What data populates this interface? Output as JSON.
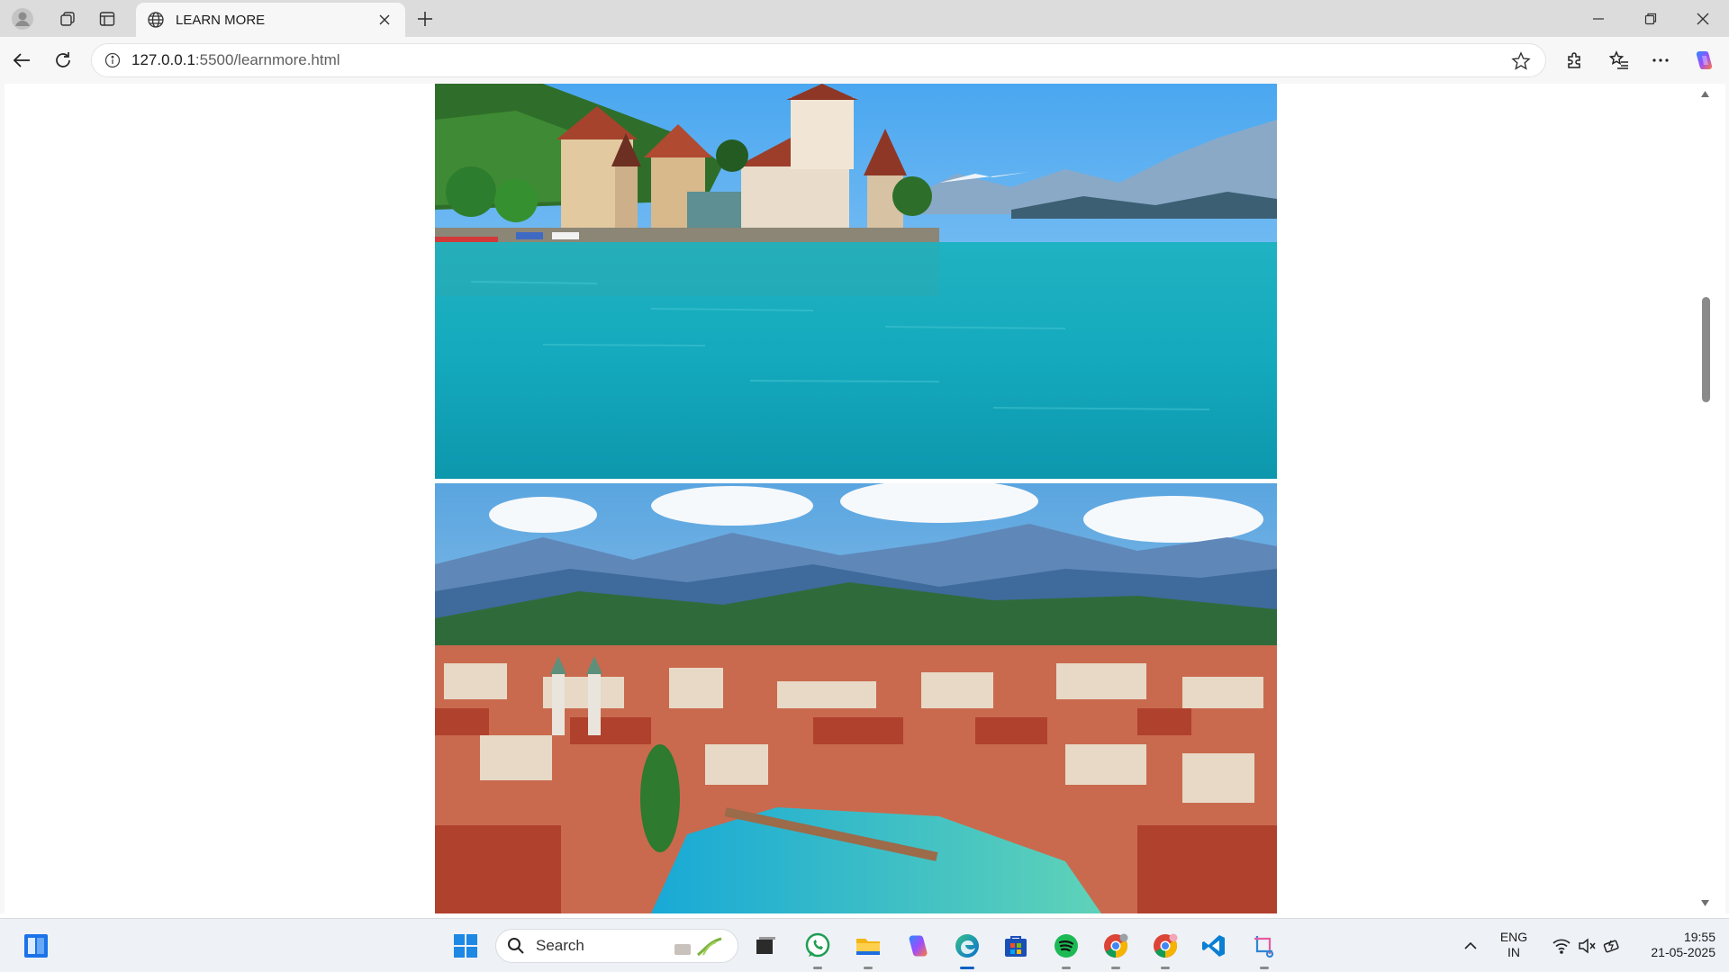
{
  "browser": {
    "tab": {
      "title": "LEARN MORE",
      "icon": "globe-icon"
    },
    "address_bar": {
      "host": "127.0.0.1",
      "path": ":5500/learnmore.html"
    }
  },
  "page": {
    "images": [
      {
        "name": "lake-castle-photo",
        "description_icon": "photo"
      },
      {
        "name": "city-river-photo",
        "description_icon": "photo"
      }
    ]
  },
  "taskbar": {
    "search_label": "Search",
    "language": {
      "line1": "ENG",
      "line2": "IN"
    },
    "clock": {
      "time": "19:55",
      "date": "21-05-2025"
    }
  },
  "colors": {
    "accent": "#0a5fc4",
    "tabstrip": "#dcdcdc",
    "toolbar": "#f7f7f7",
    "taskbar": "#eef1f6"
  }
}
